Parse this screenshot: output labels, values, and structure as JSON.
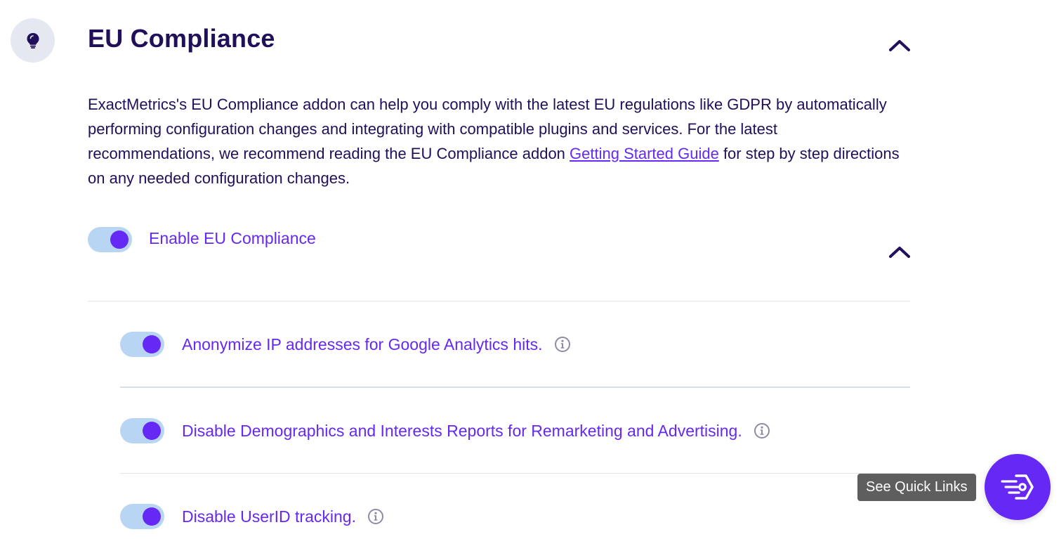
{
  "section": {
    "icon": "lightbulb-icon",
    "title": "EU Compliance",
    "collapse_icon": "chevron-up-icon"
  },
  "description": {
    "text_before_link": "ExactMetrics's EU Compliance addon can help you comply with the latest EU regulations like GDPR by automatically performing configuration changes and integrating with compatible plugins and services. For the latest recommendations, we recommend reading the EU Compliance addon ",
    "link_text": "Getting Started Guide",
    "text_after_link": " for step by step directions on any needed configuration changes."
  },
  "main_toggle": {
    "label": "Enable EU Compliance",
    "enabled": true
  },
  "sub_settings": [
    {
      "label": "Anonymize IP addresses for Google Analytics hits.",
      "enabled": true,
      "icon": "info-icon"
    },
    {
      "label": "Disable Demographics and Interests Reports for Remarketing and Advertising.",
      "enabled": true,
      "icon": "info-icon"
    },
    {
      "label": "Disable UserID tracking.",
      "enabled": true,
      "icon": "info-icon"
    }
  ],
  "quick_links": {
    "tooltip": "See Quick Links",
    "icon": "quick-links-icon"
  },
  "colors": {
    "primary": "#6528f5",
    "heading": "#210f59",
    "toggle_track": "#b8d6f3",
    "icon_circle_bg": "#e6e8f1",
    "tooltip_bg": "#5e5e5e",
    "info_icon": "#8f8ba6"
  }
}
